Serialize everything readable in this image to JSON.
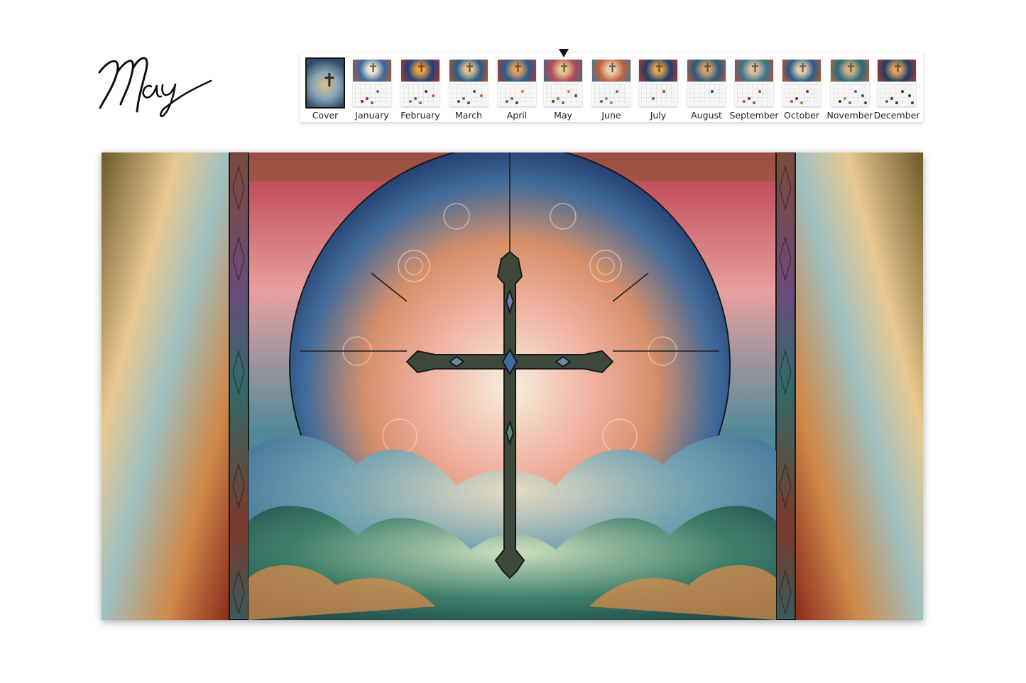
{
  "header": {
    "month_title": "May"
  },
  "thumbnail_strip": {
    "selected": "May",
    "items": [
      {
        "label": "Cover",
        "art": [
          "#2f4d6b",
          "#d9c08a",
          "#8aa6b8"
        ],
        "dots": []
      },
      {
        "label": "January",
        "art": [
          "#3a6aa0",
          "#f0e6d0",
          "#b45a34"
        ],
        "dots": [
          "#7a5a8a",
          "#8a2a2a",
          "#8a2a2a",
          "#7a5a8a"
        ]
      },
      {
        "label": "February",
        "art": [
          "#1f3f7a",
          "#e8a040",
          "#b43a2a"
        ],
        "dots": [
          "#4a3a2a",
          "#2a7a8a",
          "#c0603a",
          "#c0603a",
          "#c0603a"
        ]
      },
      {
        "label": "March",
        "art": [
          "#2a5a8a",
          "#e0c090",
          "#b45a2a"
        ],
        "dots": [
          "#3a5aa0",
          "#3a8a4a",
          "#6a3a6a",
          "#6a3a6a",
          "#c06a3a"
        ]
      },
      {
        "label": "April",
        "art": [
          "#2a5a90",
          "#e0a060",
          "#b43a2a"
        ],
        "dots": [
          "#c08a3a",
          "#7a6a5a",
          "#2a7a6a",
          "#8a2a2a"
        ]
      },
      {
        "label": "May",
        "art": [
          "#b04a5a",
          "#e8c890",
          "#3a6a8a"
        ],
        "dots": [
          "#c08a3a",
          "#b07a3a",
          "#7a2a4a",
          "#6a5aa0",
          "#7a3a2a"
        ]
      },
      {
        "label": "June",
        "art": [
          "#c0603a",
          "#e8d0b0",
          "#3a7a9a"
        ],
        "dots": [
          "#7a6a5a",
          "#c07a3a",
          "#3a7a5a",
          "#a07a9a"
        ]
      },
      {
        "label": "July",
        "art": [
          "#1f3f6a",
          "#e0a050",
          "#b43a2a"
        ],
        "dots": [
          "#b04a3a",
          "#b04a3a"
        ]
      },
      {
        "label": "August",
        "art": [
          "#2a5a7a",
          "#d0a070",
          "#b45a3a"
        ],
        "dots": [
          "#1f4a8a"
        ]
      },
      {
        "label": "September",
        "art": [
          "#3a7a8a",
          "#e0c0a0",
          "#b04a3a"
        ],
        "dots": [
          "#b04a3a",
          "#8a2a3a",
          "#c05a2a",
          "#7a5a6a"
        ]
      },
      {
        "label": "October",
        "art": [
          "#2a5a8a",
          "#e0d0b0",
          "#c05a2a"
        ],
        "dots": [
          "#8a2a2a",
          "#8a2a2a",
          "#c05a2a",
          "#c07a2a"
        ]
      },
      {
        "label": "November",
        "art": [
          "#2a6a7a",
          "#d0b080",
          "#b06a3a"
        ],
        "dots": [
          "#3a6ab0",
          "#c08a3a",
          "#5a2a3a",
          "#c05a2a",
          "#5a4a4a",
          "#8a2a3a"
        ]
      },
      {
        "label": "December",
        "art": [
          "#1f3f6a",
          "#e0a060",
          "#b43a2a"
        ],
        "dots": [
          "#2a3a6a",
          "#3a3a3a",
          "#3a7aa0",
          "#3a3a3a",
          "#3a3a3a",
          "#3a3a3a"
        ]
      }
    ]
  },
  "artwork": {
    "subject": "stained-glass cross in circular window above clouds",
    "palette": {
      "left_panel": "#b0703a",
      "right_panel": "#b0703a",
      "center_sky_red": "#b83a4a",
      "circle_blue": "#2f4f85",
      "circle_glow": "#f3e6c8",
      "cross": "#3d4a3a",
      "clouds_teal": "#3f7f7a",
      "clouds_cream": "#e8dcc0",
      "pillar": "#2f2a2a"
    }
  }
}
